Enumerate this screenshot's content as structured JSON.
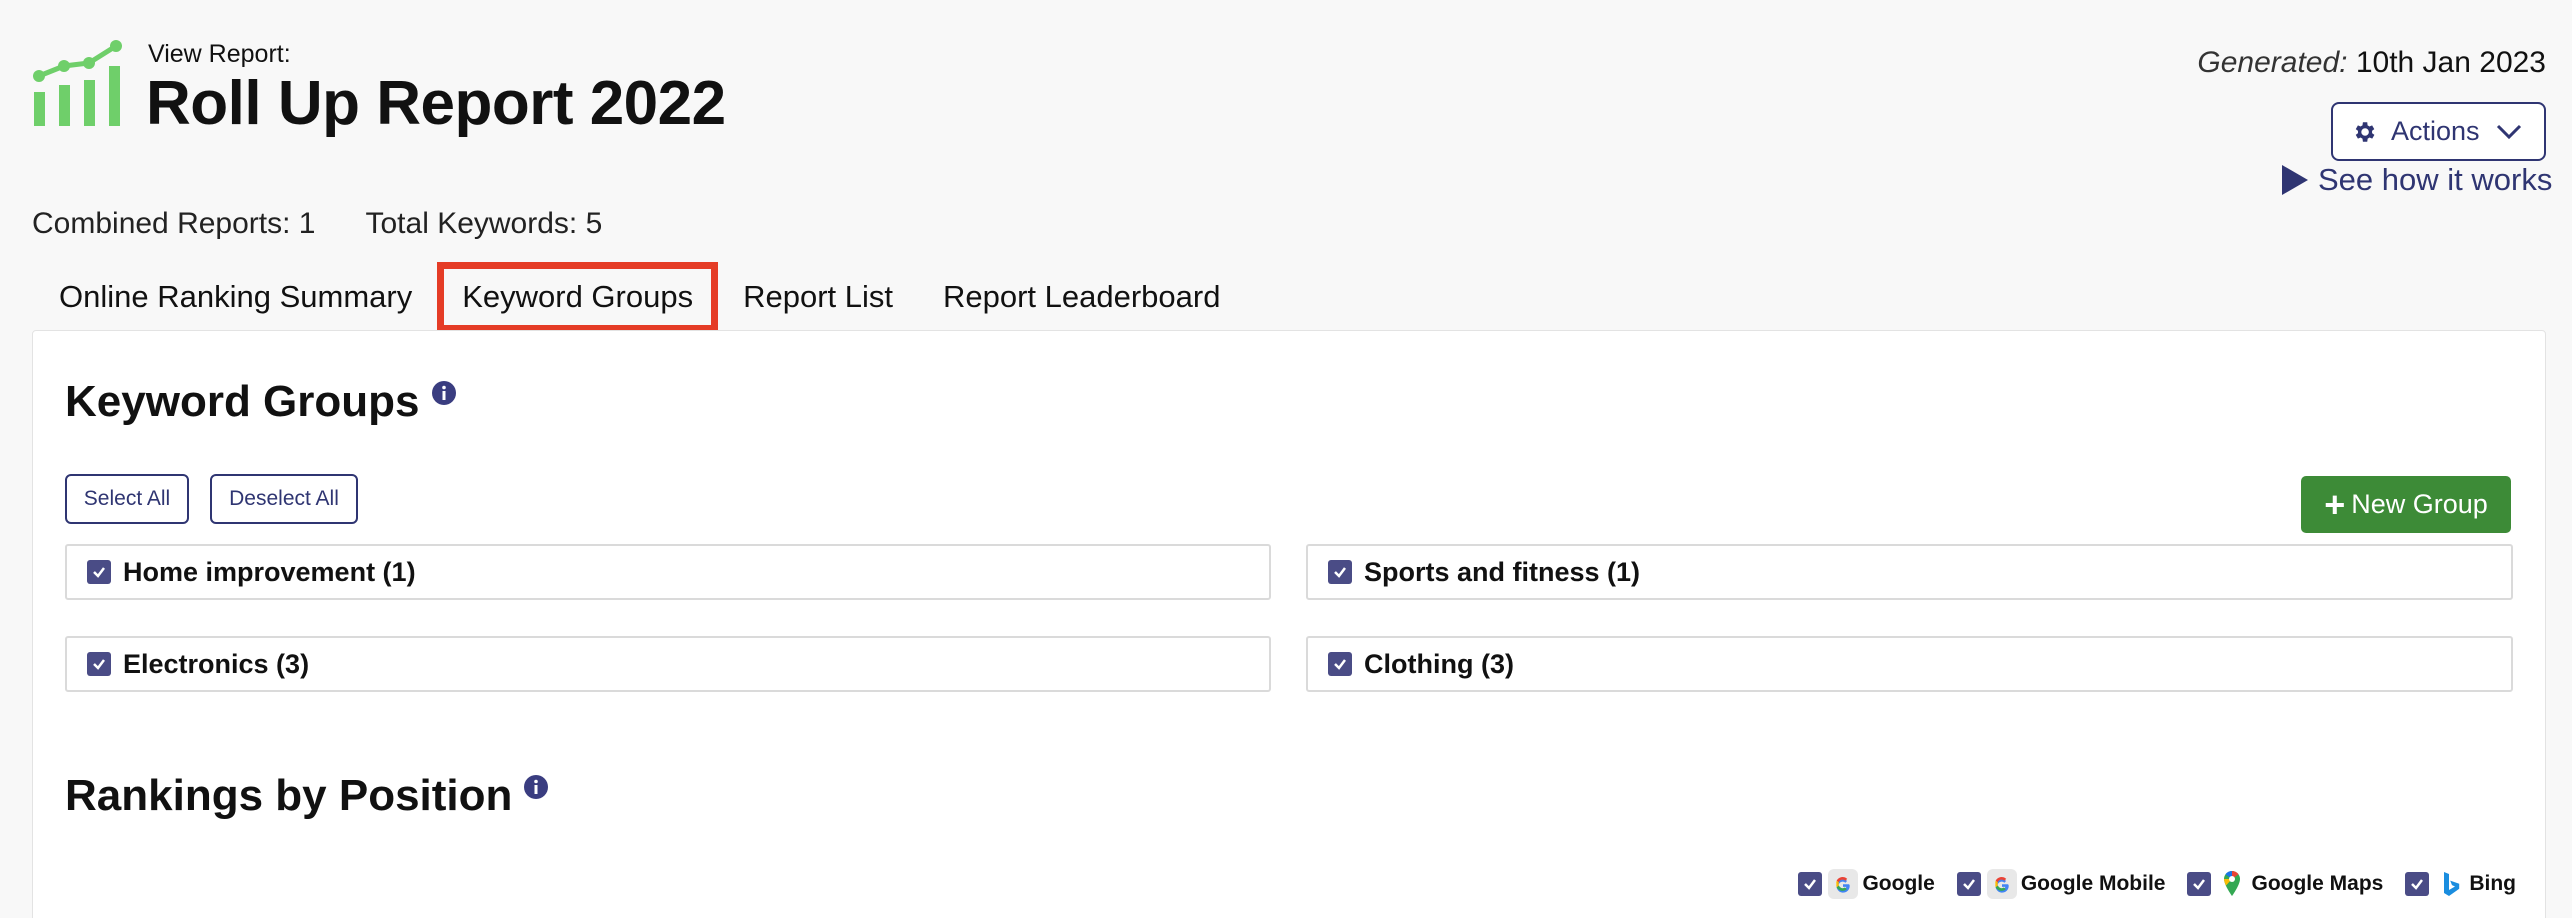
{
  "header": {
    "view_label": "View Report:",
    "title": "Roll Up Report 2022",
    "generated_label": "Generated:",
    "generated_date": "10th Jan 2023",
    "actions_label": "Actions",
    "see_how_label": "See how it works"
  },
  "stats": {
    "combined_reports": "Combined Reports: 1",
    "total_keywords": "Total Keywords: 5"
  },
  "tabs": [
    {
      "label": "Online Ranking Summary"
    },
    {
      "label": "Keyword Groups"
    },
    {
      "label": "Report List"
    },
    {
      "label": "Report Leaderboard"
    }
  ],
  "keyword_groups": {
    "title": "Keyword Groups",
    "select_all": "Select All",
    "deselect_all": "Deselect All",
    "new_group": "New Group",
    "groups": [
      {
        "label": "Home improvement (1)"
      },
      {
        "label": "Sports and fitness (1)"
      },
      {
        "label": "Electronics (3)"
      },
      {
        "label": "Clothing (3)"
      }
    ]
  },
  "rankings": {
    "title": "Rankings by Position",
    "engines": [
      {
        "label": "Google"
      },
      {
        "label": "Google Mobile"
      },
      {
        "label": "Google Maps"
      },
      {
        "label": "Bing"
      }
    ]
  },
  "colors": {
    "brand_green": "#6fcf6a",
    "navy": "#2f3572",
    "highlight_red": "#e53c26",
    "button_green": "#3d8b37"
  }
}
